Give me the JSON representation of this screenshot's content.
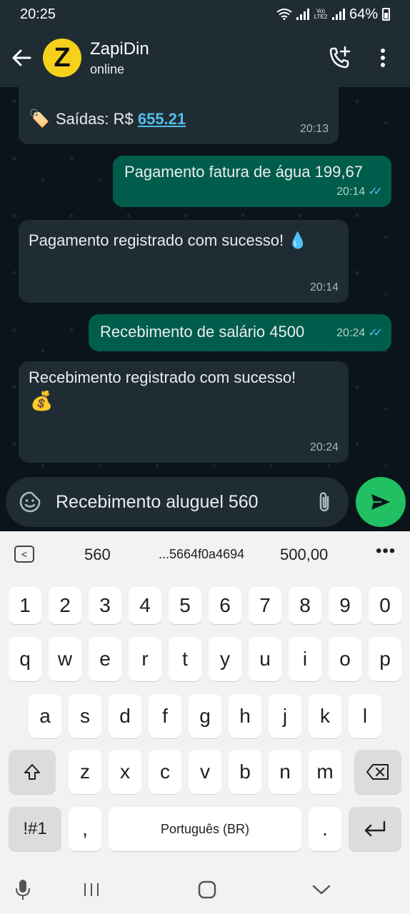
{
  "status_bar": {
    "time": "20:25",
    "network_label": "Vo) LTE2",
    "battery": "64%"
  },
  "header": {
    "avatar_letter": "Z",
    "title": "ZapiDin",
    "subtitle": "online"
  },
  "messages": [
    {
      "direction": "in",
      "text_prefix": "Saídas: R$ ",
      "link": "655.21",
      "emoji": "🏷️",
      "time": "20:13"
    },
    {
      "direction": "out",
      "text": "Pagamento fatura de água 199,67",
      "time": "20:14",
      "read": true
    },
    {
      "direction": "in",
      "text": "Pagamento registrado com sucesso! 💧",
      "time": "20:14"
    },
    {
      "direction": "out",
      "text": "Recebimento de salário 4500",
      "time": "20:24",
      "read": true
    },
    {
      "direction": "in",
      "text": "Recebimento registrado com sucesso!",
      "emoji": "💰",
      "time": "20:24"
    }
  ],
  "composer": {
    "value": "Recebimento aluguel 560"
  },
  "keyboard": {
    "suggestions": [
      "560",
      "...5664f0a4694",
      "500,00"
    ],
    "more": "•••",
    "row1": [
      "1",
      "2",
      "3",
      "4",
      "5",
      "6",
      "7",
      "8",
      "9",
      "0"
    ],
    "row2": [
      "q",
      "w",
      "e",
      "r",
      "t",
      "y",
      "u",
      "i",
      "o",
      "p"
    ],
    "row3": [
      "a",
      "s",
      "d",
      "f",
      "g",
      "h",
      "j",
      "k",
      "l"
    ],
    "row4": [
      "z",
      "x",
      "c",
      "v",
      "b",
      "n",
      "m"
    ],
    "symbols_key": "!#1",
    "comma_key": ",",
    "space_label": "Português (BR)",
    "period_key": "."
  },
  "colors": {
    "header_bg": "#1f2c34",
    "chat_bg": "#0b141a",
    "incoming_bubble": "#202c33",
    "outgoing_bubble": "#005c4b",
    "send_button": "#21c063",
    "link": "#53bdeb",
    "avatar_bg": "#f5d11b"
  }
}
